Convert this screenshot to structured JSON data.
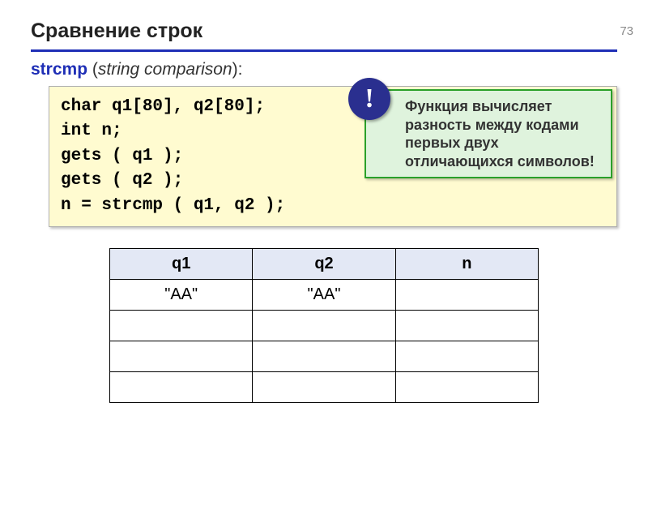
{
  "page_number": "73",
  "title": "Сравнение строк",
  "subtitle": {
    "fn": "strcmp",
    "comp": "string comparison"
  },
  "code": {
    "l1": "char q1[80], q2[80];",
    "l2": "int n;",
    "l3": "gets ( q1 );",
    "l4": "gets ( q2 );",
    "l5": "n = strcmp ( q1, q2 );"
  },
  "callout": {
    "badge": "!",
    "text": "Функция вычисляет разность между кодами первых двух отличающихся символов!"
  },
  "table": {
    "headers": [
      "q1",
      "q2",
      "n"
    ],
    "rows": [
      [
        "\"AA\"",
        "\"AA\"",
        ""
      ],
      [
        "",
        "",
        ""
      ],
      [
        "",
        "",
        ""
      ],
      [
        "",
        "",
        ""
      ]
    ]
  }
}
